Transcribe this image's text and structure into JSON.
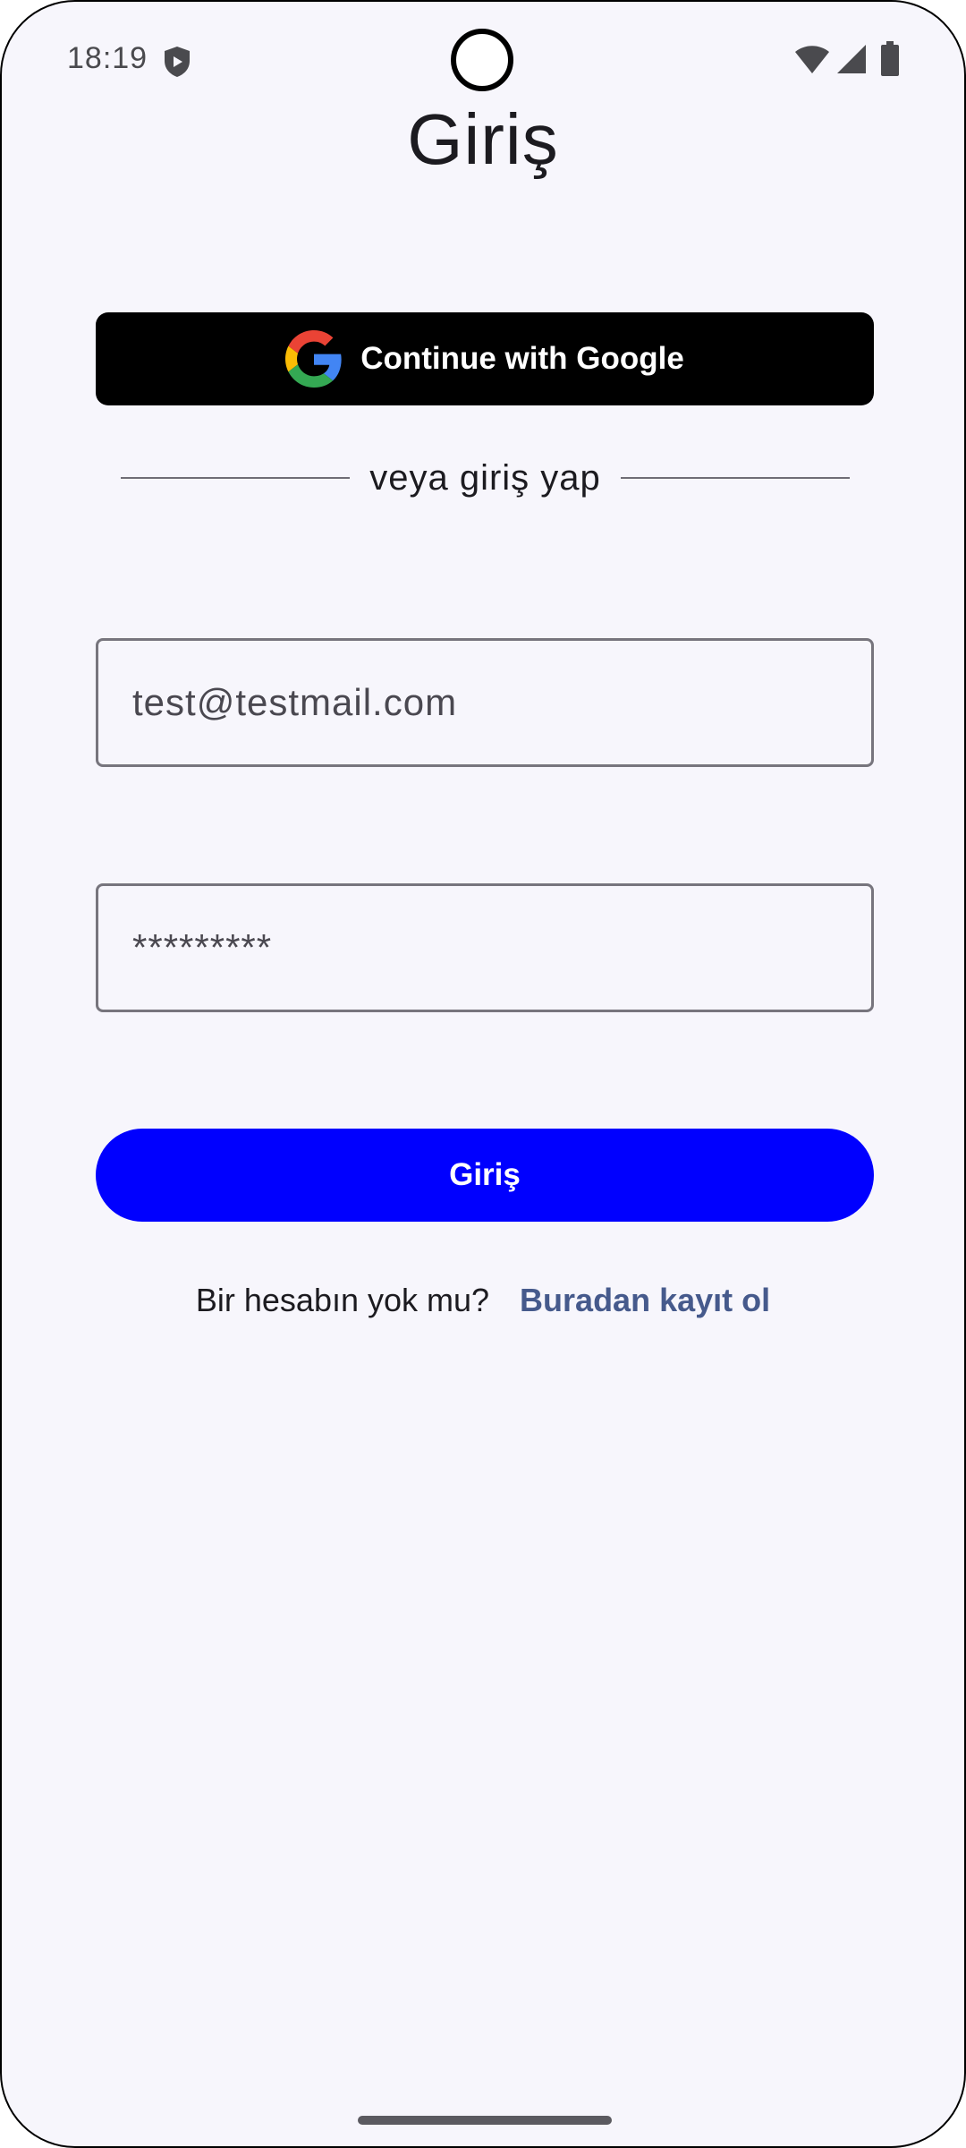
{
  "status_bar": {
    "time": "18:19",
    "icons": [
      "shield-icon",
      "wifi-icon",
      "signal-icon",
      "battery-icon"
    ]
  },
  "page": {
    "title": "Giriş"
  },
  "google_button": {
    "label": "Continue with Google",
    "icon": "google-logo-icon"
  },
  "divider": {
    "text": "veya giriş yap"
  },
  "form": {
    "email_value": "test@testmail.com",
    "password_value": "*********",
    "submit_label": "Giriş"
  },
  "register": {
    "question": "Bir hesabın yok mu?",
    "link_label": "Buradan kayıt ol"
  },
  "colors": {
    "background": "#f7f6fc",
    "google_button": "#000000",
    "primary_button": "#0000ff",
    "link": "#465a8c"
  }
}
